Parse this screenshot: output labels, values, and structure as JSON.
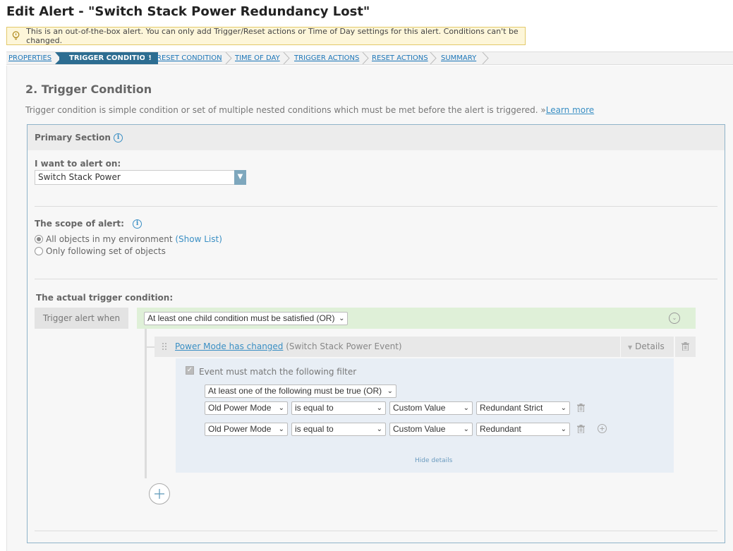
{
  "page": {
    "title": "Edit Alert - \"Switch Stack Power Redundancy Lost\""
  },
  "notice": {
    "text": "This is an out-of-the-box alert. You can only add Trigger/Reset actions or Time of Day settings for this alert. Conditions can't be changed."
  },
  "steps": [
    {
      "label": "PROPERTIES",
      "active": false
    },
    {
      "label": "TRIGGER CONDITION",
      "active": true
    },
    {
      "label": "RESET CONDITION",
      "active": false
    },
    {
      "label": "TIME OF DAY",
      "active": false
    },
    {
      "label": "TRIGGER ACTIONS",
      "active": false
    },
    {
      "label": "RESET ACTIONS",
      "active": false
    },
    {
      "label": "SUMMARY",
      "active": false
    }
  ],
  "section": {
    "heading": "2. Trigger Condition",
    "description": "Trigger condition is simple condition or set of multiple nested conditions which must be met before the alert is triggered. »",
    "learn_more": "Learn more"
  },
  "primary": {
    "title": "Primary Section",
    "alert_on_label": "I want to alert on:",
    "alert_on_value": "Switch Stack Power",
    "scope_label": "The scope of alert:",
    "scope_all": "All objects in my environment",
    "show_list": "(Show List)",
    "scope_some": "Only following set of objects",
    "actual_label": "The actual trigger condition:",
    "trigger_when": "Trigger alert when",
    "or_condition": "At least one child condition must be satisfied (OR)"
  },
  "condition": {
    "link_text": "Power Mode has changed",
    "suffix": " (Switch Stack Power Event)",
    "details": "Details"
  },
  "filter": {
    "checkbox_label": "Event must match the following filter",
    "mode": "At least one of the following must be true (OR)",
    "rows": [
      {
        "field": "Old Power Mode",
        "op": "is equal to",
        "type": "Custom Value",
        "value": "Redundant Strict"
      },
      {
        "field": "Old Power Mode",
        "op": "is equal to",
        "type": "Custom Value",
        "value": "Redundant"
      }
    ],
    "hide_details": "Hide details"
  },
  "colors": {
    "accent": "#2d6d91",
    "link": "#3a8fc4",
    "or_bar": "#dff0d8",
    "filter_bg": "#e8eef5",
    "notice_bg": "#fdf6d9"
  }
}
